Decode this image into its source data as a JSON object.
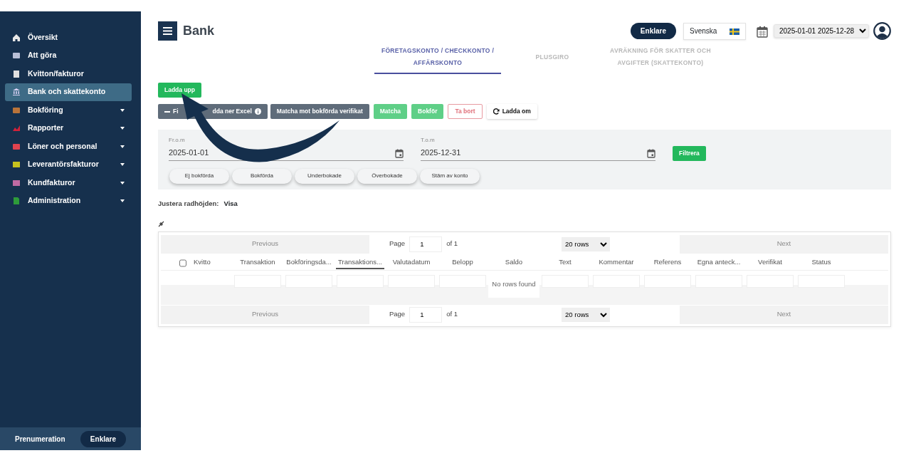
{
  "sidebar": {
    "items": [
      {
        "label": "Översikt",
        "color": "#e8e8e8",
        "selected": false,
        "expandable": false
      },
      {
        "label": "Att göra",
        "color": "#b8bfd6",
        "selected": false,
        "expandable": false
      },
      {
        "label": "Kvitton/fakturor",
        "color": "#e0e0e0",
        "selected": false,
        "expandable": false
      },
      {
        "label": "Bank och skattekonto",
        "color": "#d9d2f5",
        "selected": true,
        "expandable": false
      },
      {
        "label": "Bokföring",
        "color": "#b9733a",
        "selected": false,
        "expandable": true
      },
      {
        "label": "Rapporter",
        "color": "#d0223a",
        "selected": false,
        "expandable": true
      },
      {
        "label": "Löner och personal",
        "color": "#e0434f",
        "selected": false,
        "expandable": true
      },
      {
        "label": "Leverantörsfakturor",
        "color": "#c6c21e",
        "selected": false,
        "expandable": true
      },
      {
        "label": "Kundfakturor",
        "color": "#c06aa3",
        "selected": false,
        "expandable": true
      },
      {
        "label": "Administration",
        "color": "#2e9b3a",
        "selected": false,
        "expandable": true
      }
    ],
    "footer": {
      "label": "Prenumeration",
      "button": "Enklare"
    }
  },
  "header": {
    "title": "Bank",
    "plan_button": "Enklare",
    "language": "Svenska",
    "period": "2025-01-01 2025-12-28"
  },
  "tabs": [
    {
      "label": "FÖRETAGSKONTO / CHECKKONTO / AFFÄRSKONTO",
      "selected": true
    },
    {
      "label": "PLUSGIRO",
      "selected": false
    },
    {
      "label": "AVRÄKNING FÖR SKATTER OCH AVGIFTER (SKATTEKONTO)",
      "selected": false
    }
  ],
  "upload_button": "Ladda upp",
  "actions": [
    {
      "kind": "split",
      "label_parts": [
        "Fi",
        "dda ner Excel"
      ]
    },
    {
      "kind": "dark",
      "label": "Matcha mot bokförda verifikat"
    },
    {
      "kind": "green",
      "label": "Matcha"
    },
    {
      "kind": "green",
      "label": "Bokför"
    },
    {
      "kind": "outline-red",
      "label": "Ta bort"
    },
    {
      "kind": "reload",
      "label": "Ladda om"
    }
  ],
  "filter": {
    "from_label": "Fr.o.m",
    "from_value": "2025-01-01",
    "to_label": "T.o.m",
    "to_value": "2025-12-31",
    "button": "Filtrera",
    "chips": [
      "Ej bokförda",
      "Bokförda",
      "Underbokade",
      "Överbokade",
      "Stäm av konto"
    ]
  },
  "row_height": {
    "label": "Justera radhöjden:",
    "value": "Visa"
  },
  "table": {
    "pagers": [
      {
        "previous": "Previous",
        "page_label": "Page",
        "page": "1",
        "of": "of 1",
        "rows": "20 rows",
        "next": "Next"
      },
      {
        "previous": "Previous",
        "page_label": "Page",
        "page": "1",
        "of": "of 1",
        "rows": "20 rows",
        "next": "Next"
      }
    ],
    "checked": false,
    "columns": [
      {
        "label": "Kvitto",
        "selected": false,
        "filter": false
      },
      {
        "label": "Transaktion",
        "selected": false,
        "filter": true
      },
      {
        "label": "Bokföringsda...",
        "selected": false,
        "filter": true
      },
      {
        "label": "Transaktions...",
        "selected": true,
        "filter": true
      },
      {
        "label": "Valutadatum",
        "selected": false,
        "filter": true
      },
      {
        "label": "Belopp",
        "selected": false,
        "filter": true
      },
      {
        "label": "Saldo",
        "selected": false
      },
      {
        "label": "Text",
        "selected": false,
        "filter": true
      },
      {
        "label": "Kommentar",
        "selected": false,
        "filter": true
      },
      {
        "label": "Referens",
        "selected": false,
        "filter": true
      },
      {
        "label": "Egna anteck...",
        "selected": false,
        "filter": true
      },
      {
        "label": "Verifikat",
        "selected": false,
        "filter": true
      },
      {
        "label": "Status",
        "selected": false,
        "filter": true
      }
    ],
    "empty": "No rows found"
  }
}
